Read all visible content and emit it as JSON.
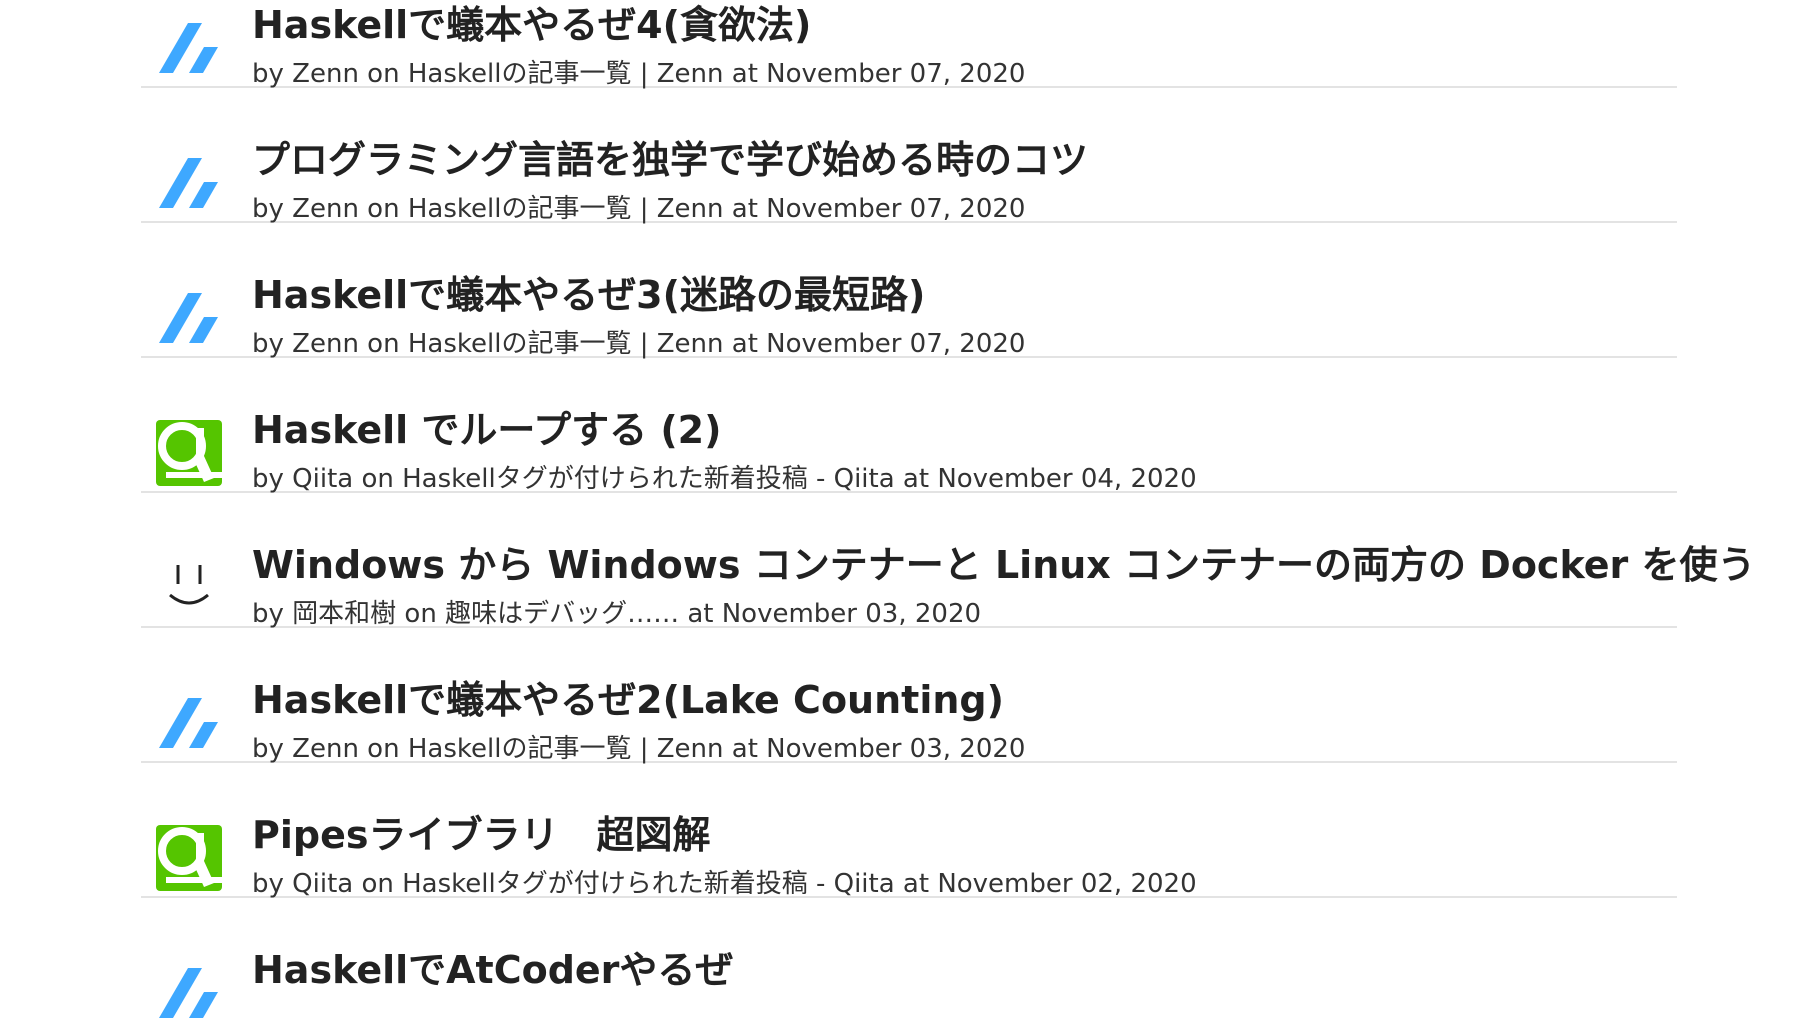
{
  "colors": {
    "zenn": "#3ea8ff",
    "qiita": "#55c500",
    "divider": "#e3e3e3",
    "text": "#222222"
  },
  "entries": [
    {
      "source": "zenn",
      "title": "Haskellで蟻本やるぜ4(貪欲法)",
      "meta": "by Zenn on Haskellの記事一覧 | Zenn at November 07, 2020"
    },
    {
      "source": "zenn",
      "title": "プログラミング言語を独学で学び始める時のコツ",
      "meta": "by Zenn on Haskellの記事一覧 | Zenn at November 07, 2020"
    },
    {
      "source": "zenn",
      "title": "Haskellで蟻本やるぜ3(迷路の最短路)",
      "meta": "by Zenn on Haskellの記事一覧 | Zenn at November 07, 2020"
    },
    {
      "source": "qiita",
      "title": "Haskell でループする (2)",
      "meta": "by Qiita on Haskellタグが付けられた新着投稿 - Qiita at November 04, 2020"
    },
    {
      "source": "smiley",
      "title": "Windows から Windows コンテナーと Linux コンテナーの両方の Docker を使う",
      "meta": "by 岡本和樹 on 趣味はデバッグ…… at November 03, 2020"
    },
    {
      "source": "zenn",
      "title": "Haskellで蟻本やるぜ2(Lake Counting)",
      "meta": "by Zenn on Haskellの記事一覧 | Zenn at November 03, 2020"
    },
    {
      "source": "qiita",
      "title": "Pipesライブラリ　超図解",
      "meta": "by Qiita on Haskellタグが付けられた新着投稿 - Qiita at November 02, 2020"
    },
    {
      "source": "zenn",
      "title": "HaskellでAtCoderやるぜ",
      "meta": ""
    }
  ]
}
